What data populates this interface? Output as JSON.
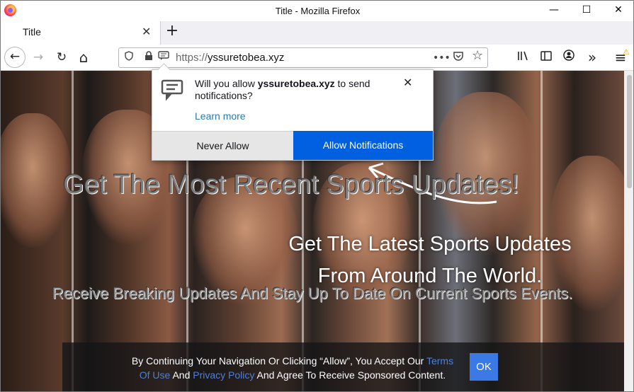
{
  "window": {
    "title": "Title - Mozilla Firefox",
    "minimize": "—",
    "maximize": "☐",
    "close": "✕"
  },
  "tab": {
    "label": "Title",
    "close": "✕",
    "new_tab": "+"
  },
  "navbar": {
    "back": "←",
    "forward": "→",
    "reload": "↻",
    "home": "⌂",
    "url_protocol": "https://",
    "url_host": "yssuretobea.xyz",
    "page_actions": "•••",
    "bookmark_star": "☆",
    "overflow": "»",
    "menu": "≡"
  },
  "popup": {
    "message_prefix": "Will you allow ",
    "message_site": "yssuretobea.xyz",
    "message_suffix": " to send notifications?",
    "learn_more": "Learn more",
    "close": "✕",
    "never_allow": "Never Allow",
    "allow_notifications": "Allow Notifications"
  },
  "page": {
    "headline": "Get The Most Recent Sports Updates!",
    "subheadline_1": "Get The Latest Sports Updates",
    "subheadline_2": "From Around The World.",
    "tagline": "Receive Breaking Updates And Stay Up To Date On Current Sports Events.",
    "consent_part1": "By Continuing Your Navigation Or Clicking “Allow”, You Accept Our ",
    "terms_link": "Terms Of Use",
    "consent_and": " And ",
    "privacy_link": "Privacy Policy",
    "consent_part2": " And Agree To Receive Sponsored Content.",
    "ok_button": "OK"
  },
  "colors": {
    "allow_button": "#0060df",
    "link": "#2a7ab0",
    "ok_button": "#3a79e6"
  }
}
